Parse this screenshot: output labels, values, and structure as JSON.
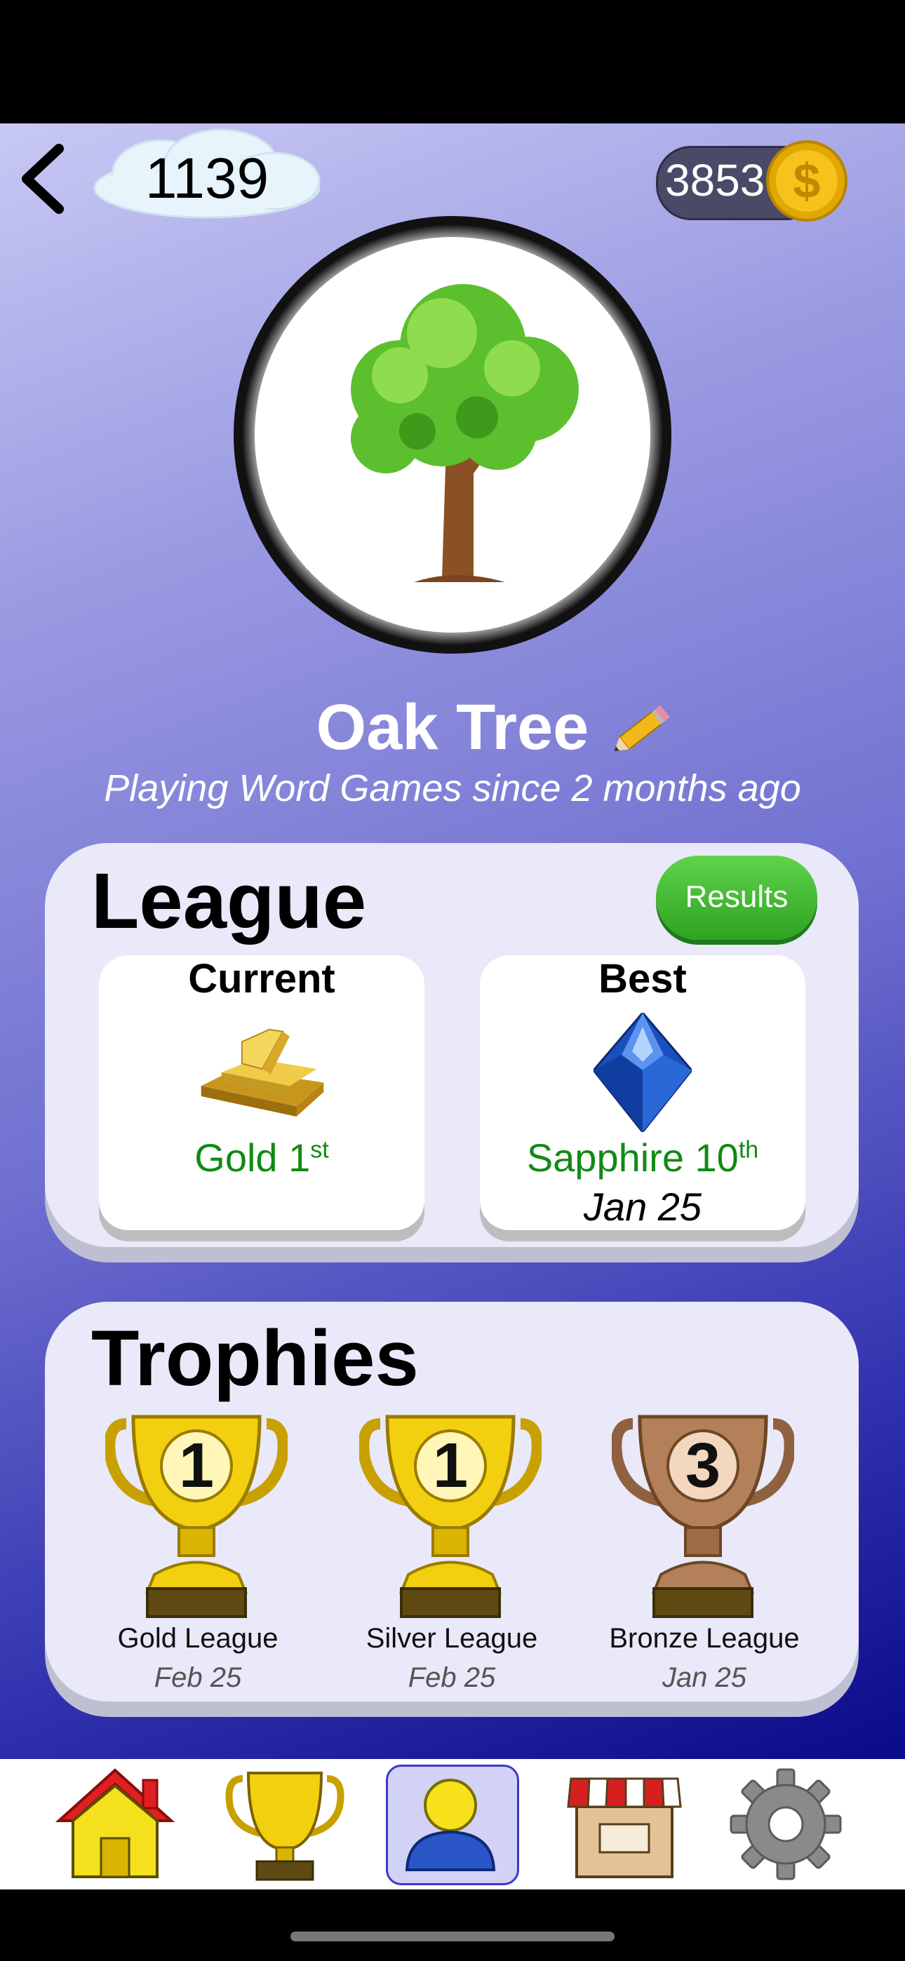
{
  "header": {
    "score": "1139",
    "coins": "3853"
  },
  "profile": {
    "name": "Oak Tree",
    "subtitle": "Playing Word Games since 2 months ago"
  },
  "league": {
    "title": "League",
    "results_label": "Results",
    "current": {
      "heading": "Current",
      "tier": "Gold 1",
      "rank_suffix": "st"
    },
    "best": {
      "heading": "Best",
      "tier": "Sapphire 10",
      "rank_suffix": "th",
      "date": "Jan 25"
    }
  },
  "trophies": {
    "title": "Trophies",
    "items": [
      {
        "name": "Gold League",
        "date": "Feb 25",
        "number": "1",
        "color": "#f3d00f"
      },
      {
        "name": "Silver League",
        "date": "Feb 25",
        "number": "1",
        "color": "#f3d00f"
      },
      {
        "name": "Bronze League",
        "date": "Jan 25",
        "number": "3",
        "color": "#b3805a"
      }
    ]
  },
  "tabs": [
    {
      "icon": "home-icon",
      "active": false
    },
    {
      "icon": "trophy-icon",
      "active": false
    },
    {
      "icon": "profile-icon",
      "active": true
    },
    {
      "icon": "shop-icon",
      "active": false
    },
    {
      "icon": "gear-icon",
      "active": false
    }
  ],
  "colors": {
    "accent_green": "#128a12",
    "active_tab": "#d2d2f7",
    "gold": "#f3c30f"
  }
}
